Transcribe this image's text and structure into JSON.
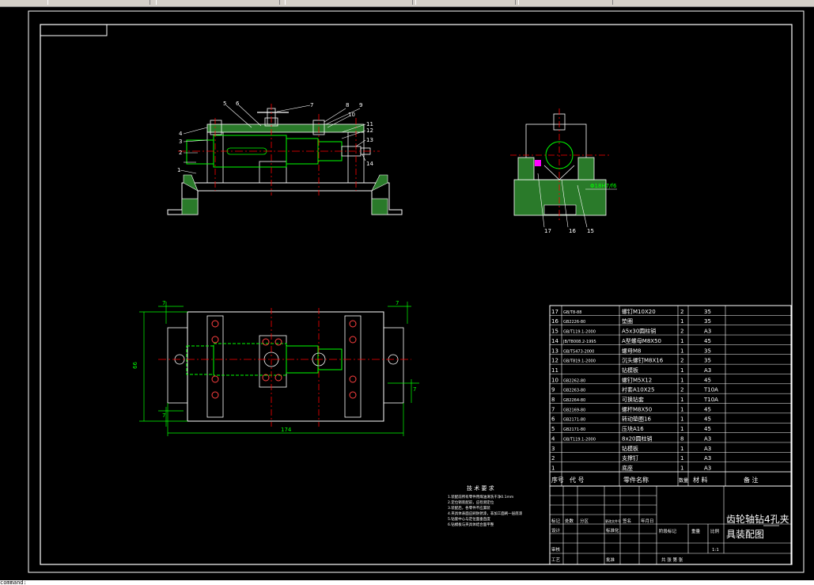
{
  "drawing": {
    "title_lines": [
      "齿轮轴钻4孔夹",
      "具装配图"
    ],
    "technical_requirements": {
      "heading": "技 术 要 求",
      "lines": [
        "1.装配前所有零件用煤油清洗干净0.1mm",
        "2.定位销装配前，应检测定位",
        "3.装配后，各零件不应漏装",
        "4.夹具体表面应刷防锈漆，非加工面刷一层底漆",
        "5.钻套中心与定位面垂直度",
        "6.钻模板与夹具体结合面平整"
      ]
    },
    "dimensions": {
      "overall_length": "174",
      "overall_height": "66",
      "small": "7",
      "fit": "Φ18H7/f6"
    },
    "balloons_front": [
      "1",
      "2",
      "3",
      "4",
      "5",
      "6",
      "7",
      "8",
      "9",
      "10",
      "11",
      "12",
      "13",
      "14"
    ],
    "balloons_side": [
      "15",
      "16",
      "17"
    ],
    "bom_rows": [
      {
        "no": "17",
        "code": "GB/T8-88",
        "name": "螺钉M10X20",
        "qty": "2",
        "material": "35",
        "remark": ""
      },
      {
        "no": "16",
        "code": "GB2226-80",
        "name": "垫圈",
        "qty": "1",
        "material": "35",
        "remark": ""
      },
      {
        "no": "15",
        "code": "GB/T119.1-2000",
        "name": "A5x30圆柱销",
        "qty": "2",
        "material": "A3",
        "remark": ""
      },
      {
        "no": "14",
        "code": "JB/T8008.2-1995",
        "name": "A型螺母M8X50",
        "qty": "1",
        "material": "45",
        "remark": ""
      },
      {
        "no": "13",
        "code": "GB/T5473-2000",
        "name": "螺母M8",
        "qty": "1",
        "material": "35",
        "remark": ""
      },
      {
        "no": "12",
        "code": "GB/T819.1-2000",
        "name": "沉头螺钉M8X16",
        "qty": "2",
        "material": "35",
        "remark": ""
      },
      {
        "no": "11",
        "code": "",
        "name": "钻模板",
        "qty": "1",
        "material": "A3",
        "remark": ""
      },
      {
        "no": "10",
        "code": "GB2262-80",
        "name": "螺钉M5X12",
        "qty": "1",
        "material": "45",
        "remark": ""
      },
      {
        "no": "9",
        "code": "GB2263-80",
        "name": "衬套A10X25",
        "qty": "2",
        "material": "T10A",
        "remark": ""
      },
      {
        "no": "8",
        "code": "GB2264-80",
        "name": "可换钻套",
        "qty": "1",
        "material": "T10A",
        "remark": ""
      },
      {
        "no": "7",
        "code": "GB2169-80",
        "name": "螺杆M8X50",
        "qty": "1",
        "material": "45",
        "remark": ""
      },
      {
        "no": "6",
        "code": "GB2171-80",
        "name": "转动垫圈16",
        "qty": "1",
        "material": "45",
        "remark": ""
      },
      {
        "no": "5",
        "code": "GB2171-80",
        "name": "压块A16",
        "qty": "1",
        "material": "45",
        "remark": ""
      },
      {
        "no": "4",
        "code": "GB/T119.1-2000",
        "name": "8x20圆柱销",
        "qty": "8",
        "material": "A3",
        "remark": ""
      },
      {
        "no": "3",
        "code": "",
        "name": "钻模板",
        "qty": "1",
        "material": "A3",
        "remark": ""
      },
      {
        "no": "2",
        "code": "",
        "name": "支撑钉",
        "qty": "1",
        "material": "A3",
        "remark": ""
      },
      {
        "no": "1",
        "code": "",
        "name": "底座",
        "qty": "1",
        "material": "A3",
        "remark": ""
      }
    ],
    "bom_header": {
      "no": "序号",
      "code": "代    号",
      "name": "零件名称",
      "qty": "数量",
      "material": "材  料",
      "remark": "备  注"
    },
    "title_block": {
      "labels_left": [
        "标记",
        "设计",
        "审核",
        "工艺"
      ],
      "labels_row": [
        "处数",
        "分区",
        "更改文件号",
        "签名",
        "年月日"
      ],
      "labels_mid": [
        "标准化",
        "批准"
      ],
      "labels_stage": [
        "阶段标记",
        "重量",
        "比例"
      ],
      "scale": "1:1",
      "sheet": "共   张   第   张"
    }
  },
  "status": {
    "command_line": "command:"
  },
  "colors": {
    "background": "#000000",
    "outline": "#ffffff",
    "green": "#00ff00",
    "red": "#ff0000",
    "cyan": "#00ffff",
    "hatch": "#33aa33",
    "yellow": "#ffff00",
    "magenta": "#ff00ff"
  }
}
